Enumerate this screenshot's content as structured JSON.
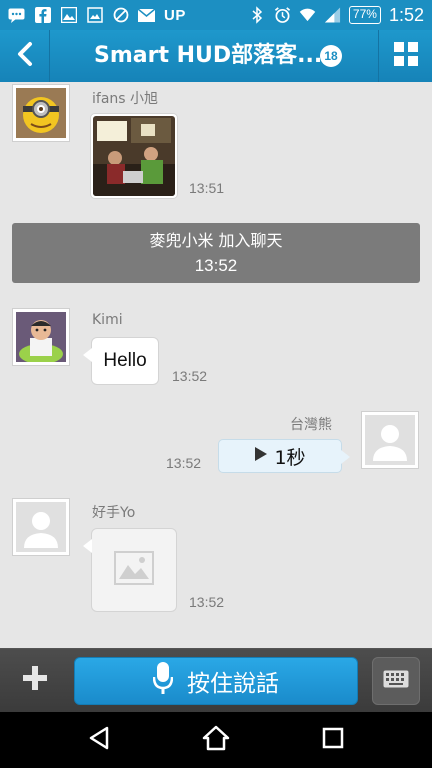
{
  "status_bar": {
    "label": "UP",
    "battery": "77%",
    "time": "1:52"
  },
  "header": {
    "title": "Smart HUD部落客...",
    "badge": "18"
  },
  "messages": [
    {
      "sender": "ifans  小旭",
      "time": "13:51"
    },
    {
      "system_line1": "麥兜小米 加入聊天",
      "system_time": "13:52"
    },
    {
      "sender": "Kimi",
      "text": "Hello",
      "time": "13:52"
    },
    {
      "sender": "台灣熊",
      "voice": "1秒",
      "time": "13:52"
    },
    {
      "sender": "好手Yo",
      "time": "13:52"
    }
  ],
  "input": {
    "talk_label": "按住說話"
  },
  "colors": {
    "accent": "#1c8fc2",
    "talk_button": "#1f98d8",
    "system_bg": "#7b7b7b"
  }
}
